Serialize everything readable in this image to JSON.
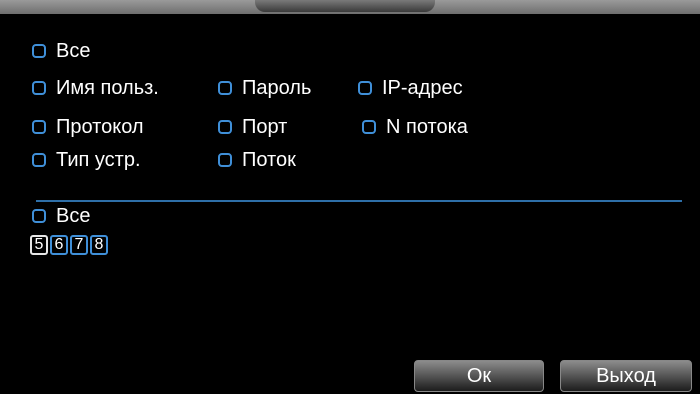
{
  "filters": {
    "all": "Все",
    "username": "Имя польз.",
    "password": "Пароль",
    "ip": "IP-адрес",
    "protocol": "Протокол",
    "port": "Порт",
    "stream_no": "N потока",
    "device_type": "Тип устр.",
    "stream": "Поток"
  },
  "channels": {
    "all": "Все",
    "items": [
      "5",
      "6",
      "7",
      "8"
    ],
    "active": "5"
  },
  "buttons": {
    "ok": "Ок",
    "exit": "Выход"
  },
  "colors": {
    "accent": "#3f8fd8",
    "background": "#000000"
  }
}
